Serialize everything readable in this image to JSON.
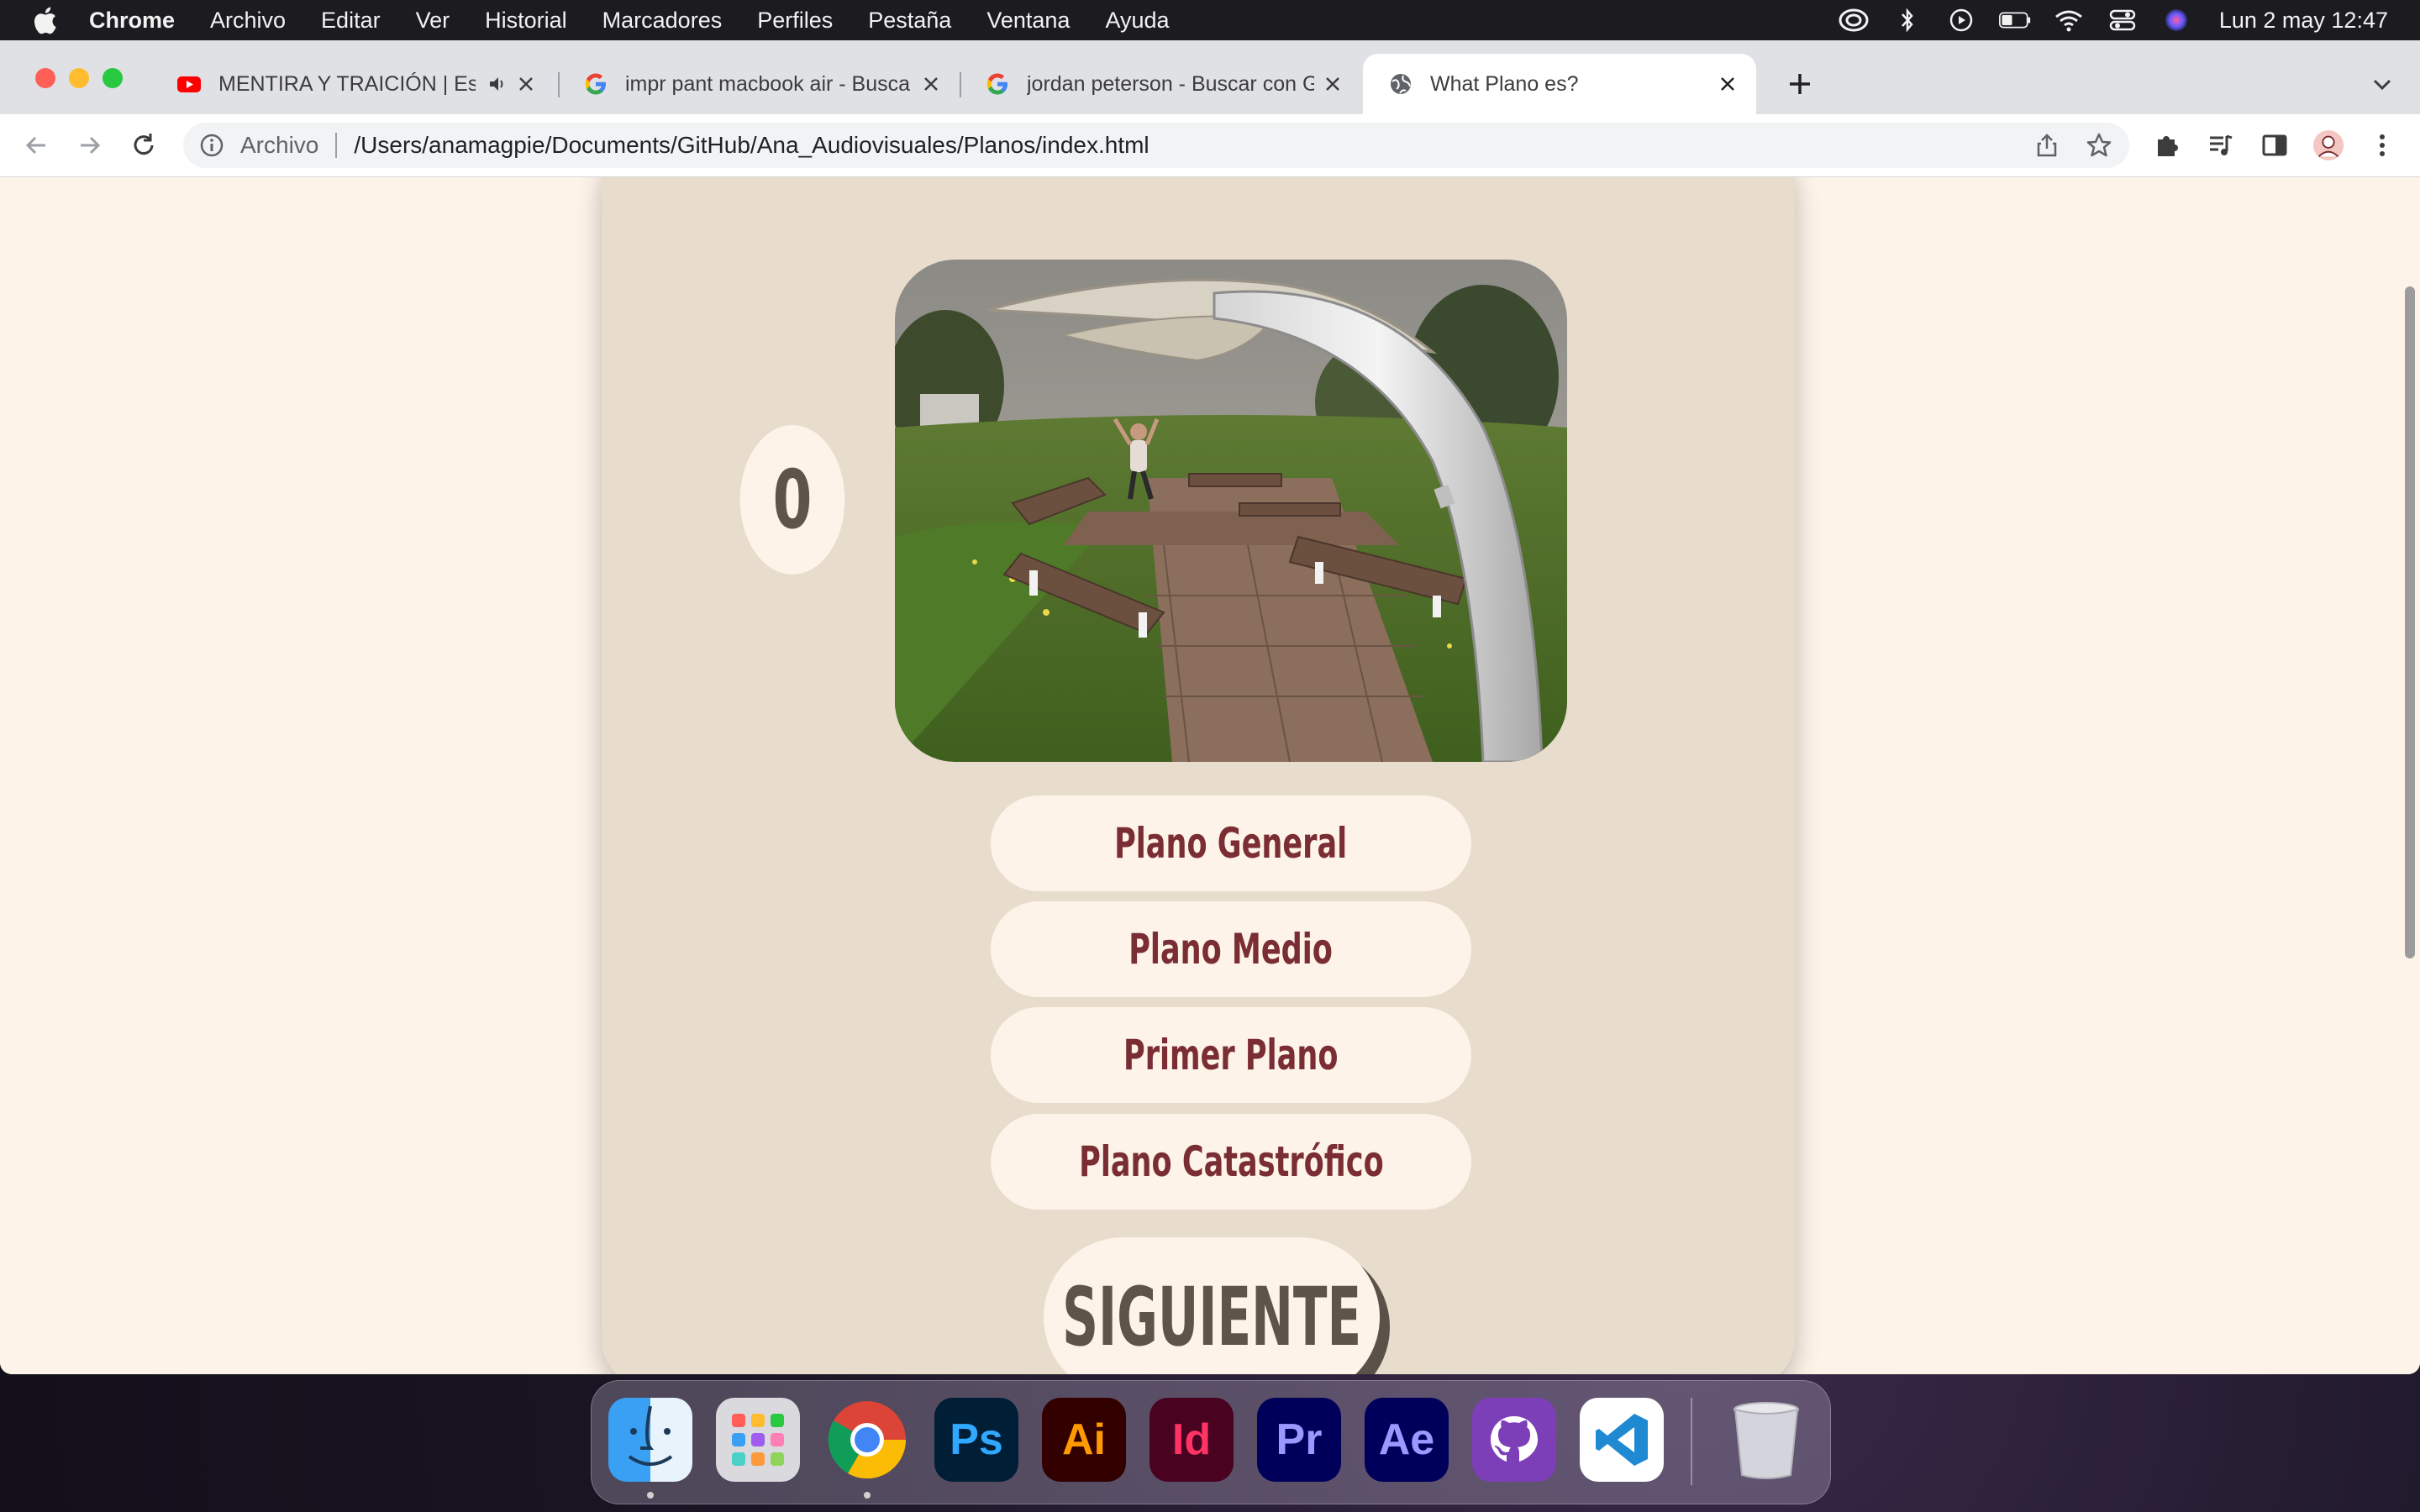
{
  "menubar": {
    "app": "Chrome",
    "items": [
      "Archivo",
      "Editar",
      "Ver",
      "Historial",
      "Marcadores",
      "Perfiles",
      "Pestaña",
      "Ventana",
      "Ayuda"
    ],
    "clock": "Lun 2 may  12:47",
    "status_icons": [
      "creative-cloud-icon",
      "bluetooth-icon",
      "play-circle-icon",
      "battery-icon",
      "wifi-icon",
      "control-center-icon",
      "siri-icon"
    ]
  },
  "tabs": [
    {
      "title": "MENTIRA Y TRAICIÓN | Est",
      "favicon": "youtube-icon",
      "audio": true,
      "active": false
    },
    {
      "title": "impr pant macbook air - Busca",
      "favicon": "google-icon",
      "active": false
    },
    {
      "title": "jordan peterson - Buscar con G",
      "favicon": "google-icon",
      "active": false
    },
    {
      "title": "What Plano es?",
      "favicon": "globe-icon",
      "active": true
    }
  ],
  "omnibox": {
    "scheme_label": "Archivo",
    "url": "/Users/anamagpie/Documents/GitHub/Ana_Audiovisuales/Planos/index.html"
  },
  "quiz": {
    "score": "0",
    "options": [
      "Plano General",
      "Plano Medio",
      "Primer Plano",
      "Plano Catastrófico"
    ],
    "next_label": "SIGUIENTE"
  },
  "dock": {
    "apps": [
      {
        "name": "finder-icon",
        "label": ""
      },
      {
        "name": "launchpad-icon",
        "label": ""
      },
      {
        "name": "chrome-icon",
        "label": ""
      },
      {
        "name": "photoshop-icon",
        "label": "Ps",
        "bg": "#001e36",
        "fg": "#31a8ff"
      },
      {
        "name": "illustrator-icon",
        "label": "Ai",
        "bg": "#330000",
        "fg": "#ff9a00"
      },
      {
        "name": "indesign-icon",
        "label": "Id",
        "bg": "#49021f",
        "fg": "#ff3366"
      },
      {
        "name": "premiere-icon",
        "label": "Pr",
        "bg": "#00005b",
        "fg": "#9999ff"
      },
      {
        "name": "after-effects-icon",
        "label": "Ae",
        "bg": "#00005b",
        "fg": "#9999ff"
      },
      {
        "name": "github-desktop-icon",
        "label": ""
      },
      {
        "name": "vscode-icon",
        "label": ""
      },
      {
        "name": "trash-icon",
        "label": ""
      }
    ]
  },
  "colors": {
    "page_bg": "#fdf3e8",
    "card_bg": "#e8dccc",
    "answer_text": "#7a2d33",
    "score_text": "#5e544a"
  }
}
